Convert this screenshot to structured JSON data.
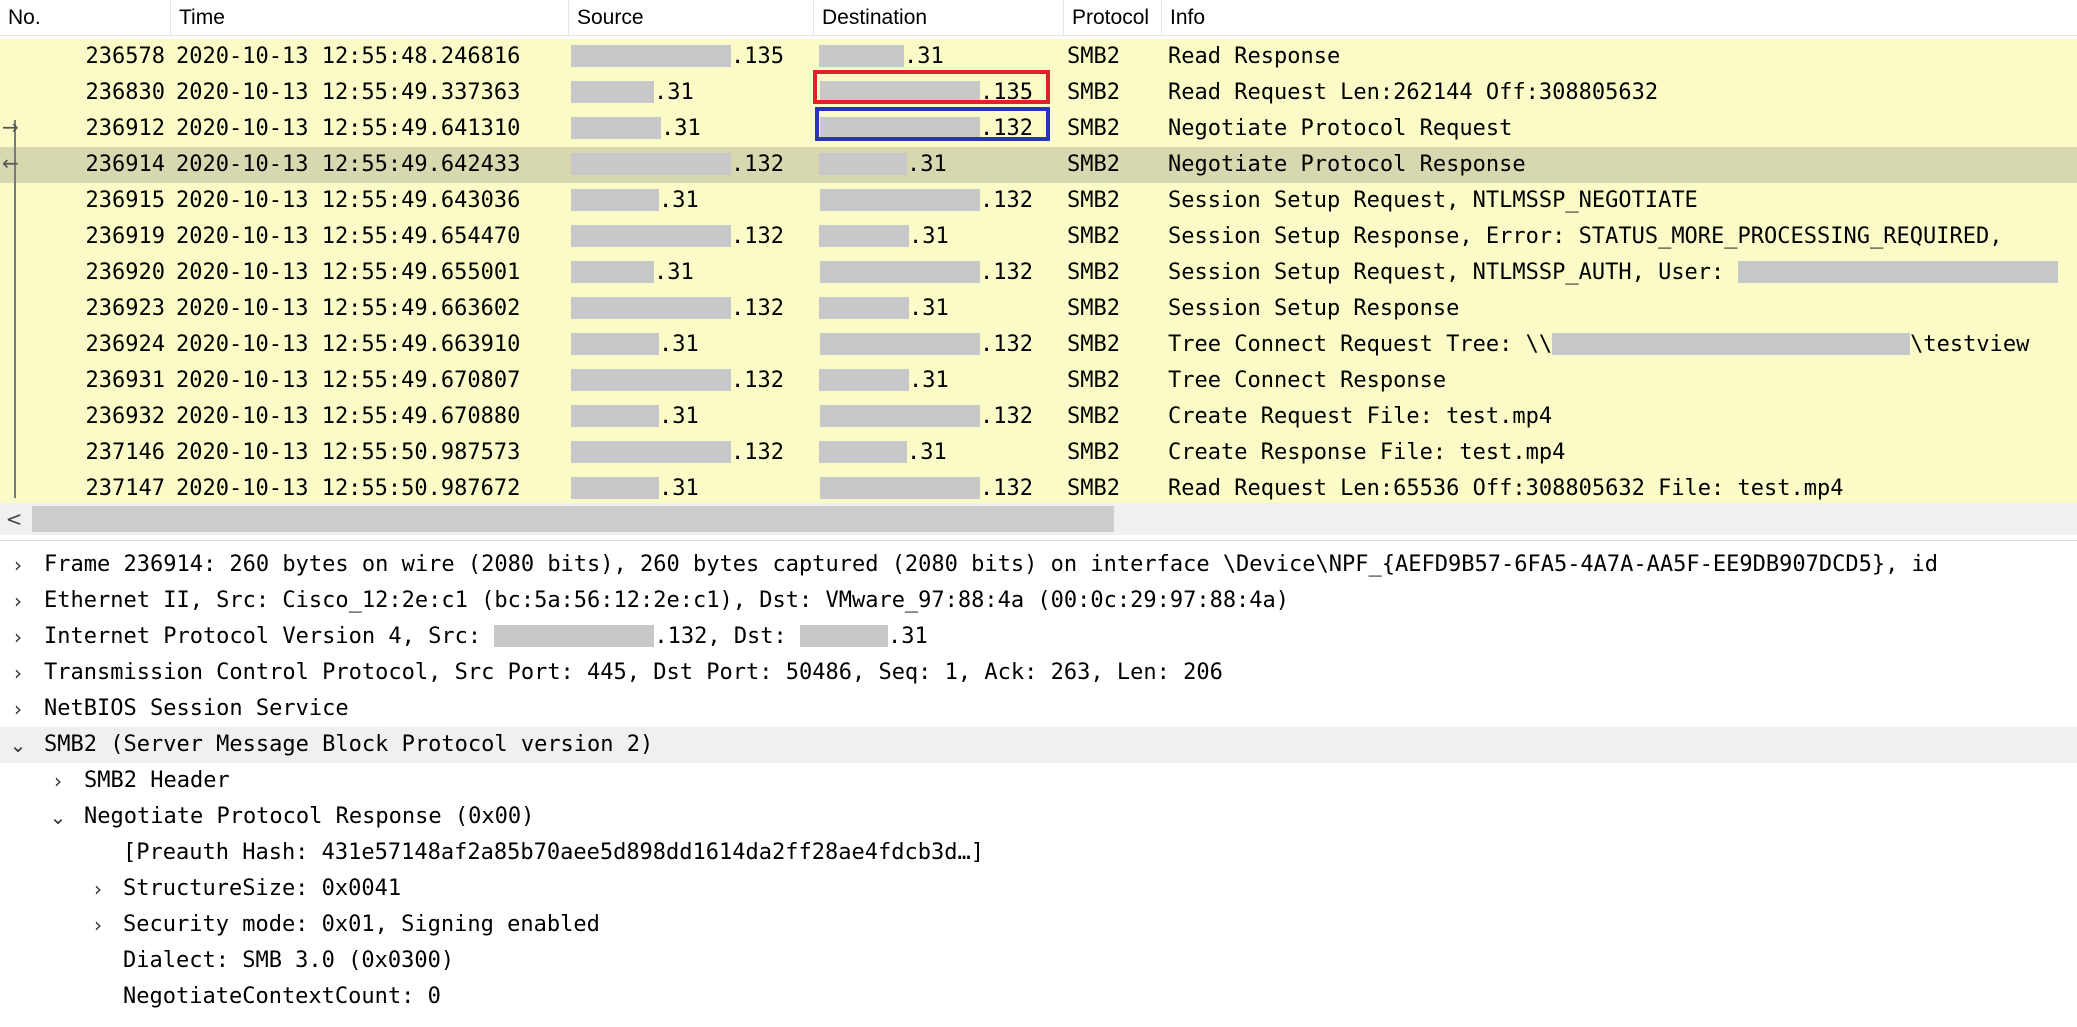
{
  "packet_list": {
    "columns": {
      "no": "No.",
      "time": "Time",
      "source": "Source",
      "destination": "Destination",
      "protocol": "Protocol",
      "info": "Info"
    },
    "rows": [
      {
        "no": "236578",
        "time": "2020-10-13 12:55:48.246816",
        "src": ".135",
        "dst": ".31",
        "proto": "SMB2",
        "info": "Read Response"
      },
      {
        "no": "236830",
        "time": "2020-10-13 12:55:49.337363",
        "src": ".31",
        "dst": ".135",
        "proto": "SMB2",
        "info": "Read Request Len:262144 Off:308805632"
      },
      {
        "no": "236912",
        "time": "2020-10-13 12:55:49.641310",
        "src": ".31",
        "dst": ".132",
        "proto": "SMB2",
        "info": "Negotiate Protocol Request"
      },
      {
        "no": "236914",
        "time": "2020-10-13 12:55:49.642433",
        "src": ".132",
        "dst": ".31",
        "proto": "SMB2",
        "info": "Negotiate Protocol Response"
      },
      {
        "no": "236915",
        "time": "2020-10-13 12:55:49.643036",
        "src": ".31",
        "dst": ".132",
        "proto": "SMB2",
        "info": "Session Setup Request, NTLMSSP_NEGOTIATE"
      },
      {
        "no": "236919",
        "time": "2020-10-13 12:55:49.654470",
        "src": ".132",
        "dst": ".31",
        "proto": "SMB2",
        "info": "Session Setup Response, Error: STATUS_MORE_PROCESSING_REQUIRED,"
      },
      {
        "no": "236920",
        "time": "2020-10-13 12:55:49.655001",
        "src": ".31",
        "dst": ".132",
        "proto": "SMB2",
        "info": "Session Setup Request, NTLMSSP_AUTH, User: "
      },
      {
        "no": "236923",
        "time": "2020-10-13 12:55:49.663602",
        "src": ".132",
        "dst": ".31",
        "proto": "SMB2",
        "info": "Session Setup Response"
      },
      {
        "no": "236924",
        "time": "2020-10-13 12:55:49.663910",
        "src": ".31",
        "dst": ".132",
        "proto": "SMB2",
        "info_pre": "Tree Connect Request Tree: \\\\",
        "info_post": "\\testview"
      },
      {
        "no": "236931",
        "time": "2020-10-13 12:55:49.670807",
        "src": ".132",
        "dst": ".31",
        "proto": "SMB2",
        "info": "Tree Connect Response"
      },
      {
        "no": "236932",
        "time": "2020-10-13 12:55:49.670880",
        "src": ".31",
        "dst": ".132",
        "proto": "SMB2",
        "info": "Create Request File: test.mp4"
      },
      {
        "no": "237146",
        "time": "2020-10-13 12:55:50.987573",
        "src": ".132",
        "dst": ".31",
        "proto": "SMB2",
        "info": "Create Response File: test.mp4"
      },
      {
        "no": "237147",
        "time": "2020-10-13 12:55:50.987672",
        "src": ".31",
        "dst": ".132",
        "proto": "SMB2",
        "info": "Read Request Len:65536 Off:308805632 File: test.mp4"
      }
    ],
    "scroll_left_icon": "<"
  },
  "details": {
    "frame": "Frame 236914: 260 bytes on wire (2080 bits), 260 bytes captured (2080 bits) on interface \\Device\\NPF_{AEFD9B57-6FA5-4A7A-AA5F-EE9DB907DCD5}, id",
    "ethernet": "Ethernet II, Src: Cisco_12:2e:c1 (bc:5a:56:12:2e:c1), Dst: VMware_97:88:4a (00:0c:29:97:88:4a)",
    "ip_pre": "Internet Protocol Version 4, Src: ",
    "ip_mid": ".132, Dst: ",
    "ip_post": ".31",
    "tcp": "Transmission Control Protocol, Src Port: 445, Dst Port: 50486, Seq: 1, Ack: 263, Len: 206",
    "netbios": "NetBIOS Session Service",
    "smb2": "SMB2 (Server Message Block Protocol version 2)",
    "smb2_header": "SMB2 Header",
    "negotiate": "Negotiate Protocol Response (0x00)",
    "preauth": "[Preauth Hash: 431e57148af2a85b70aee5d898dd1614da2ff28ae4fdcb3d…]",
    "structure_size": "StructureSize: 0x0041",
    "security_mode": "Security mode: 0x01, Signing enabled",
    "dialect": "Dialect: SMB 3.0 (0x0300)",
    "context_count": "NegotiateContextCount: 0"
  },
  "icons": {
    "collapsed": "chevron-right-icon",
    "expanded": "chevron-down-icon"
  },
  "colors": {
    "row_bg": "#fbfbc7",
    "row_selected": "#d7d7b0",
    "redaction": "#c8c8c8",
    "highlight_red": "#e0202a",
    "highlight_blue": "#2a34b8"
  }
}
